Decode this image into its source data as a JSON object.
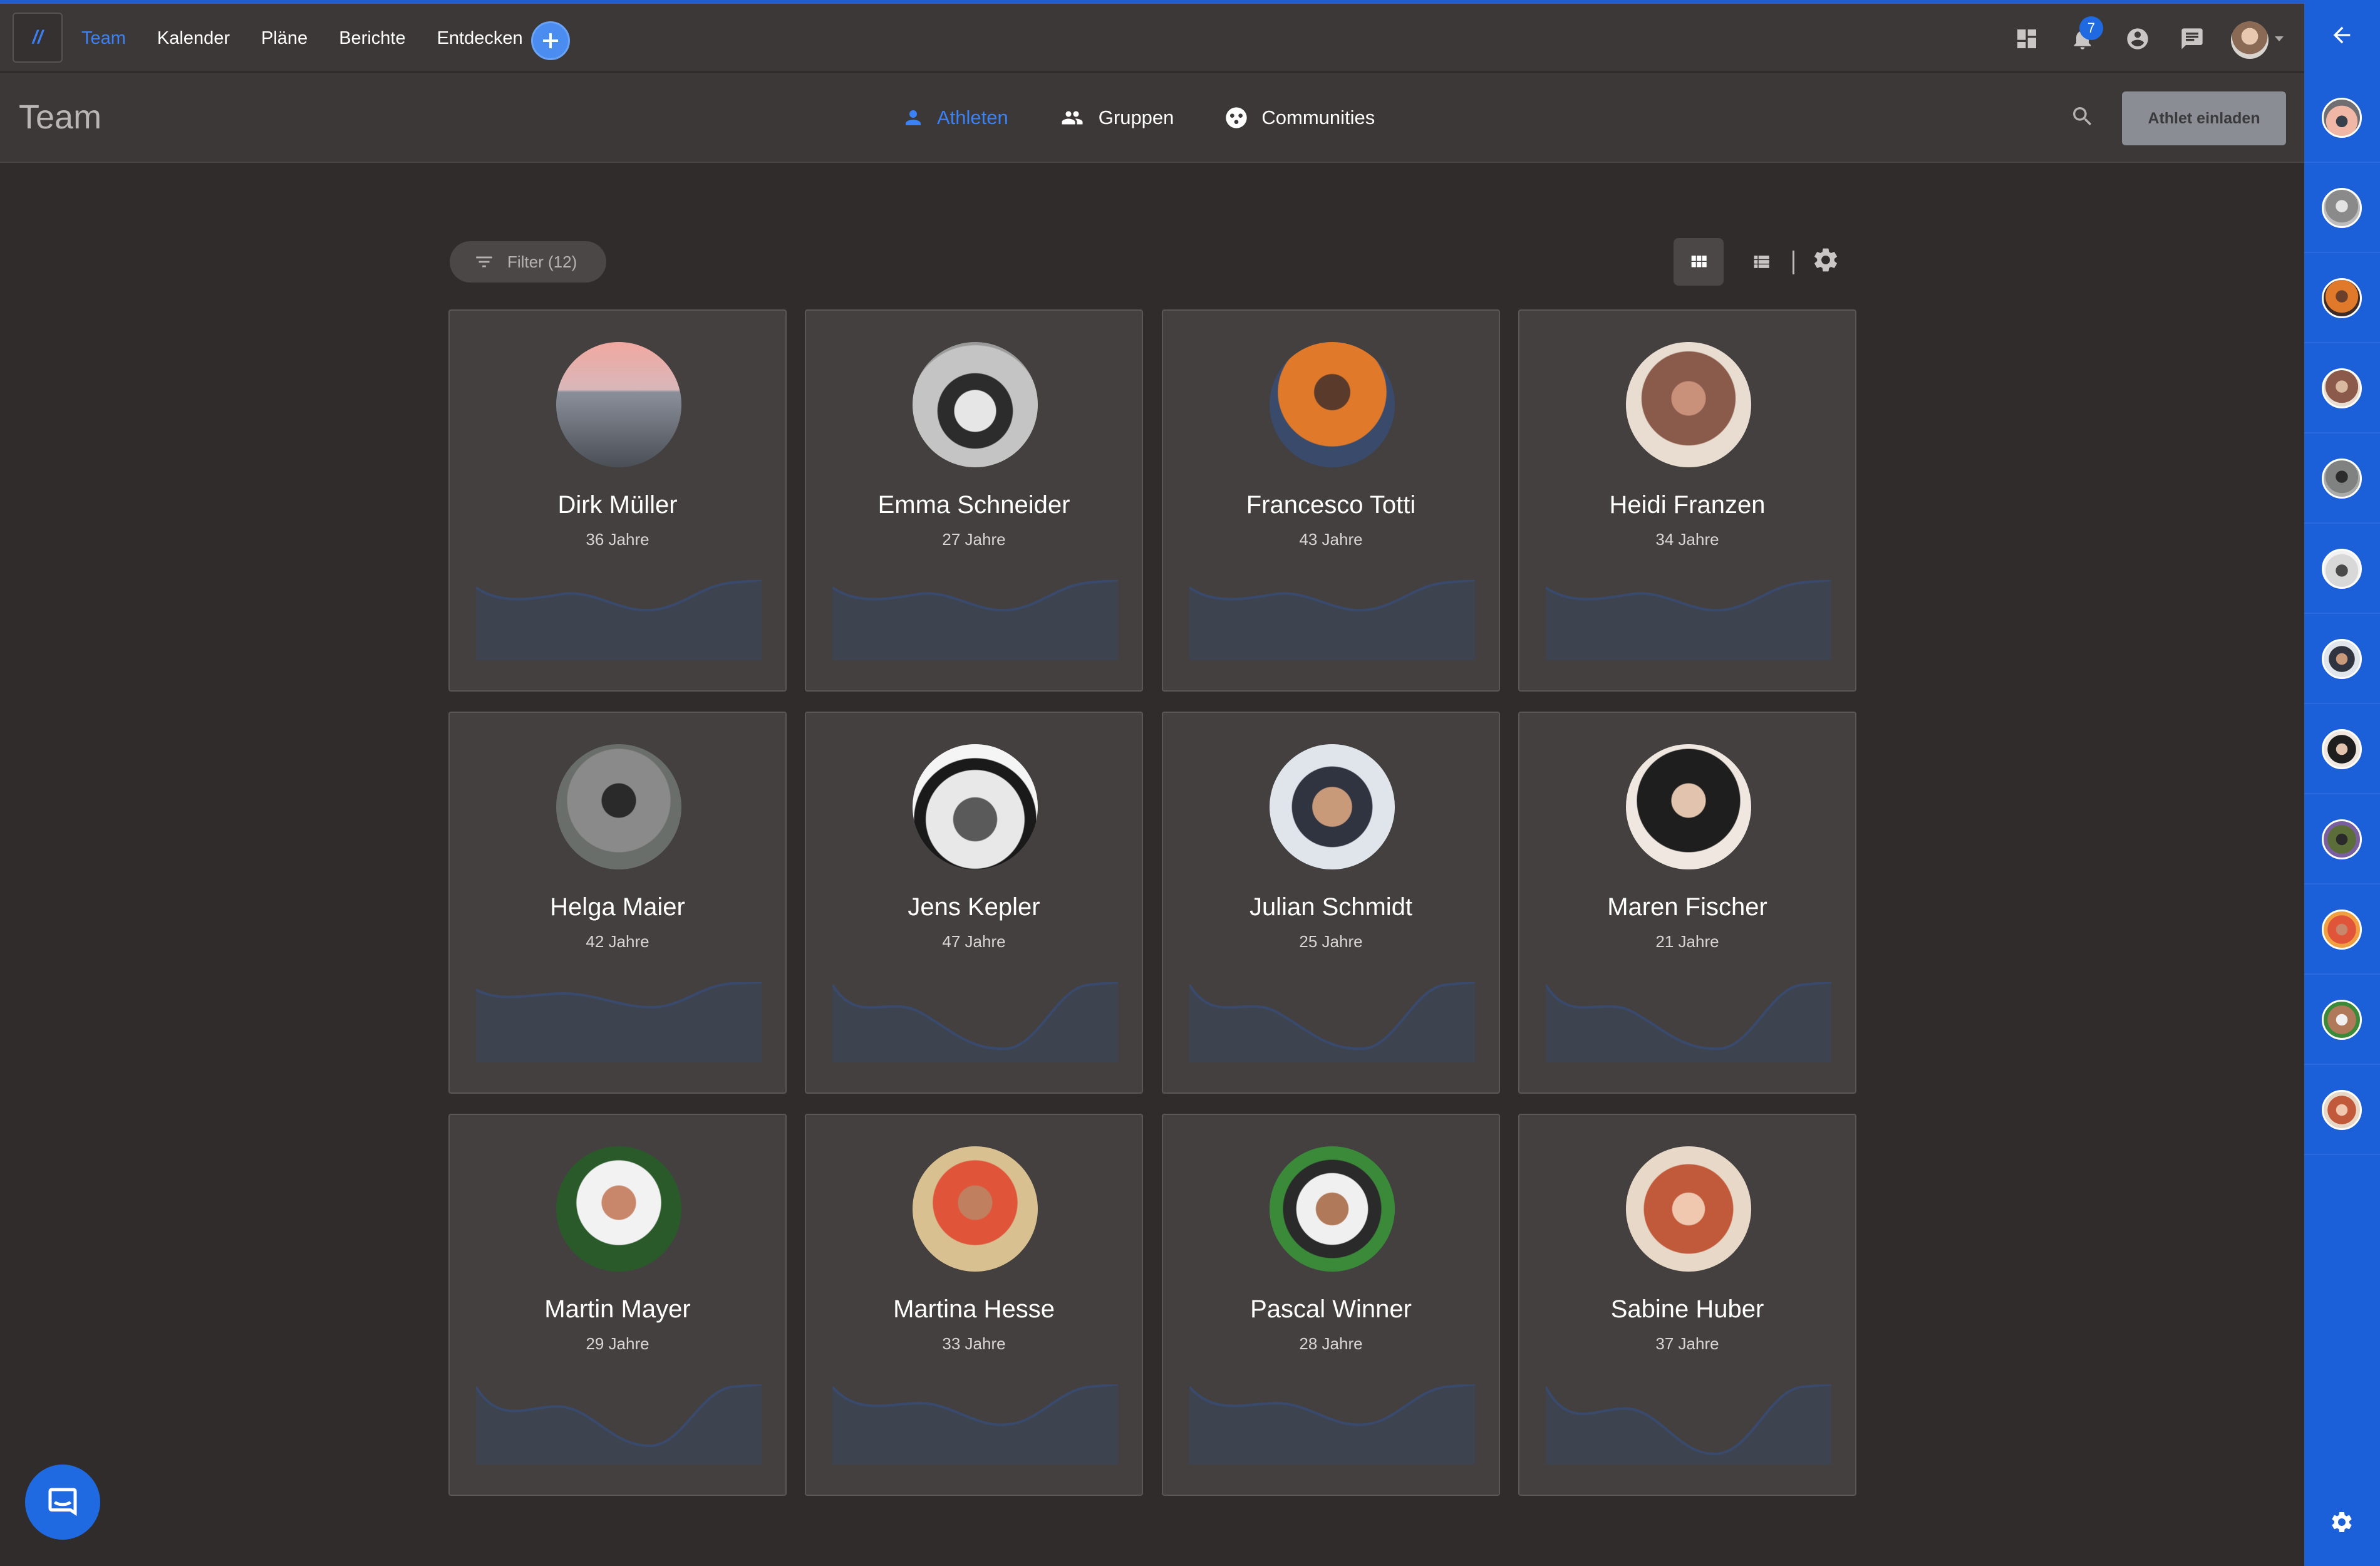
{
  "topnav": {
    "logo": "//",
    "links": [
      "Team",
      "Kalender",
      "Pläne",
      "Berichte",
      "Entdecken"
    ],
    "active": "Team",
    "notification_count": "7"
  },
  "subheader": {
    "title": "Team",
    "tabs": [
      "Athleten",
      "Gruppen",
      "Communities"
    ],
    "active_tab": "Athleten",
    "invite_label": "Athlet einladen"
  },
  "toolbar": {
    "filter_label": "Filter (12)"
  },
  "athletes": [
    {
      "name": "Dirk Müller",
      "age": "36 Jahre"
    },
    {
      "name": "Emma Schneider",
      "age": "27 Jahre"
    },
    {
      "name": "Francesco Totti",
      "age": "43 Jahre"
    },
    {
      "name": "Heidi Franzen",
      "age": "34 Jahre"
    },
    {
      "name": "Helga Maier",
      "age": "42 Jahre"
    },
    {
      "name": "Jens Kepler",
      "age": "47 Jahre"
    },
    {
      "name": "Julian Schmidt",
      "age": "25 Jahre"
    },
    {
      "name": "Maren Fischer",
      "age": "21 Jahre"
    },
    {
      "name": "Martin Mayer",
      "age": "29 Jahre"
    },
    {
      "name": "Martina Hesse",
      "age": "33 Jahre"
    },
    {
      "name": "Pascal Winner",
      "age": "28 Jahre"
    },
    {
      "name": "Sabine Huber",
      "age": "37 Jahre"
    }
  ],
  "colors": {
    "accent": "#3b82f6",
    "sidebar": "#1b5fd9",
    "card": "#43403f",
    "background": "#2f2c2b"
  }
}
